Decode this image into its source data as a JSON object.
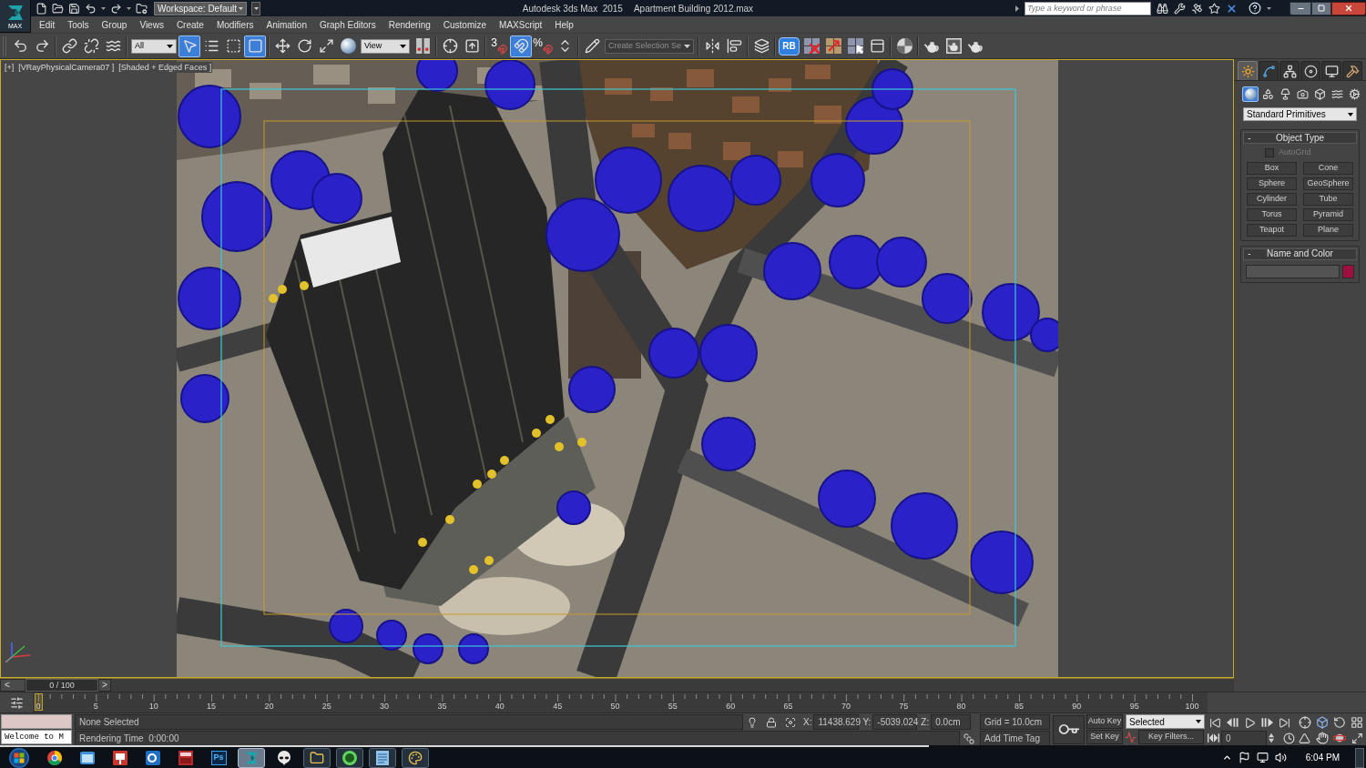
{
  "title_bar": {
    "app_button_label": "MAX",
    "workspace": "Workspace: Default",
    "app_title": "Autodesk 3ds Max  2015",
    "file_name": "Apartment Building 2012.max",
    "search": {
      "placeholder": "Type a keyword or phrase"
    }
  },
  "menu_bar": [
    "Edit",
    "Tools",
    "Group",
    "Views",
    "Create",
    "Modifiers",
    "Animation",
    "Graph Editors",
    "Rendering",
    "Customize",
    "MAXScript",
    "Help"
  ],
  "main_toolbar": [
    {
      "kind": "button",
      "active": false
    },
    {
      "kind": "button",
      "active": false
    },
    {
      "kind": "separator"
    },
    {
      "kind": "button",
      "active": false
    },
    {
      "kind": "button",
      "active": false
    },
    {
      "kind": "button",
      "active": false
    },
    {
      "kind": "separator"
    },
    {
      "kind": "dropdown",
      "value": "All"
    },
    {
      "kind": "button",
      "active": true
    },
    {
      "kind": "button",
      "active": false
    },
    {
      "kind": "button",
      "active": false
    },
    {
      "kind": "button",
      "active": true
    },
    {
      "kind": "separator"
    },
    {
      "kind": "button",
      "active": false
    },
    {
      "kind": "button",
      "active": false
    },
    {
      "kind": "button",
      "active": false
    },
    {
      "kind": "button",
      "active": false
    },
    {
      "kind": "dropdown",
      "value": "View"
    },
    {
      "kind": "button",
      "active": false
    },
    {
      "kind": "separator"
    },
    {
      "kind": "button",
      "active": false
    },
    {
      "kind": "button",
      "active": false
    },
    {
      "kind": "separator"
    },
    {
      "kind": "snap",
      "label": "3",
      "active": false
    },
    {
      "kind": "button",
      "active": true
    },
    {
      "kind": "snap",
      "label": "%",
      "active": false
    },
    {
      "kind": "button",
      "active": false
    },
    {
      "kind": "separator"
    },
    {
      "kind": "button",
      "active": false
    },
    {
      "kind": "dropdown",
      "value": "Create Selection Se"
    },
    {
      "kind": "separator"
    },
    {
      "kind": "button",
      "active": false
    },
    {
      "kind": "button",
      "active": false
    },
    {
      "kind": "separator"
    },
    {
      "kind": "button",
      "active": false
    },
    {
      "kind": "separator"
    },
    {
      "kind": "text_button",
      "label": "RB"
    },
    {
      "kind": "button",
      "active": false
    },
    {
      "kind": "button",
      "active": false
    },
    {
      "kind": "button",
      "active": false
    },
    {
      "kind": "button",
      "active": false
    },
    {
      "kind": "separator"
    },
    {
      "kind": "button",
      "active": false
    },
    {
      "kind": "separator"
    },
    {
      "kind": "button",
      "active": false
    },
    {
      "kind": "button",
      "active": false
    },
    {
      "kind": "button",
      "active": false
    }
  ],
  "viewport": {
    "active": true,
    "labels": [
      "[+]",
      "[VRayPhysicalCamera07 ]",
      "[Shaded + Edged Faces ]"
    ]
  },
  "command_panel": {
    "tabs": [
      {
        "selected": true
      },
      {
        "selected": false
      },
      {
        "selected": false
      },
      {
        "selected": false
      },
      {
        "selected": false
      },
      {
        "selected": false
      }
    ],
    "categories": [
      {
        "selected": true
      },
      {
        "selected": false
      },
      {
        "selected": false
      },
      {
        "selected": false
      },
      {
        "selected": false
      },
      {
        "selected": false
      },
      {
        "selected": false
      }
    ],
    "dropdown": "Standard Primitives",
    "rollouts": [
      {
        "kind": "object_type",
        "toggle": "-",
        "title": "Object Type",
        "expanded": true,
        "autogrid": {
          "label": "AutoGrid",
          "checked": false,
          "disabled": true
        },
        "buttons": [
          "Box",
          "Cone",
          "Sphere",
          "GeoSphere",
          "Cylinder",
          "Tube",
          "Torus",
          "Pyramid",
          "Teapot",
          "Plane"
        ]
      },
      {
        "kind": "name_and_color",
        "toggle": "-",
        "title": "Name and Color",
        "expanded": true,
        "color": "#9c0f3e"
      }
    ]
  },
  "time_slider": {
    "prev": "<",
    "label": "0 / 100",
    "next": ">",
    "level": 0
  },
  "track_bar": {
    "frame_labels": [
      "0",
      "5",
      "10",
      "15",
      "20",
      "25",
      "30",
      "35",
      "40",
      "45",
      "50",
      "55",
      "60",
      "65",
      "70",
      "75",
      "80",
      "85",
      "90",
      "95",
      "100"
    ]
  },
  "status_bar": {
    "listener_output": "Welcome to M",
    "prompt": "None Selected",
    "rendering_time": "Rendering Time  0:00:00",
    "coordinates": [
      {
        "axis": "X:",
        "value": "11438.629"
      },
      {
        "axis": "Y:",
        "value": "-5039.024"
      },
      {
        "axis": "Z:",
        "value": "0.0cm"
      }
    ],
    "grid": "Grid = 10.0cm",
    "add_time_tag": "Add Time Tag",
    "auto_key": {
      "label": "Auto Key",
      "on": false
    },
    "key_filter_mode": "Selected",
    "set_key": "Set Key",
    "key_filters": "Key Filters...",
    "current_frame": "0"
  },
  "taskbar": {
    "apps": [
      {
        "running": false,
        "active": false
      },
      {
        "running": false,
        "active": false
      },
      {
        "running": false,
        "active": false
      },
      {
        "running": false,
        "active": false
      },
      {
        "running": false,
        "active": false
      },
      {
        "running": false,
        "active": false,
        "label": "Ps"
      },
      {
        "running": true,
        "active": true
      },
      {
        "running": false,
        "active": false
      },
      {
        "running": true,
        "active": false
      },
      {
        "running": true,
        "active": false
      },
      {
        "running": true,
        "active": false
      },
      {
        "running": true,
        "active": false
      }
    ],
    "clock": "6:04 PM"
  }
}
